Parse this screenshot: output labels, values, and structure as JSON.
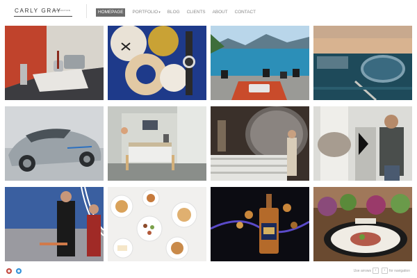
{
  "site": {
    "logo_main": "CARLY GRAY",
    "logo_sub": "PRODUCTION"
  },
  "nav": {
    "items": [
      {
        "label": "HOMEPAGE",
        "active": true
      },
      {
        "label": "PORTFOLIO",
        "has_dropdown": true
      },
      {
        "label": "BLOG"
      },
      {
        "label": "CLIENTS"
      },
      {
        "label": "ABOUT"
      },
      {
        "label": "CONTACT"
      }
    ]
  },
  "footer": {
    "hint_prefix": "Use arrows",
    "hint_key_prev": "‹",
    "hint_key_next": "›",
    "hint_suffix": "for navigation",
    "social_icons": [
      "pinterest-icon",
      "twitter-icon"
    ]
  },
  "colors": {
    "active_nav_bg": "#6b6b6b",
    "nav_text": "#8a8a8a",
    "pinterest": "#c2453a",
    "twitter": "#2f8fd8"
  }
}
